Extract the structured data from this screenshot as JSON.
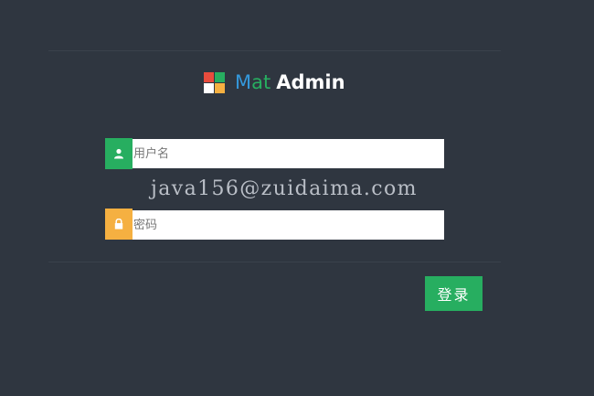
{
  "logo": {
    "brand_m": "M",
    "brand_at": "at",
    "brand_admin": "Admin",
    "colors": {
      "red": "#e84c3d",
      "green": "#27ae60",
      "white": "#ffffff",
      "orange": "#f5b041",
      "blue": "#3498db"
    }
  },
  "form": {
    "username": {
      "placeholder": "用户名",
      "value": "",
      "icon": "user-icon",
      "accent": "#27ae60"
    },
    "password": {
      "placeholder": "密码",
      "value": "",
      "icon": "lock-icon",
      "accent": "#f5b041"
    },
    "submit_label": "登录"
  },
  "watermark": "java156@zuidaima.com",
  "theme": {
    "background": "#2f3640",
    "primary": "#27ae60"
  }
}
